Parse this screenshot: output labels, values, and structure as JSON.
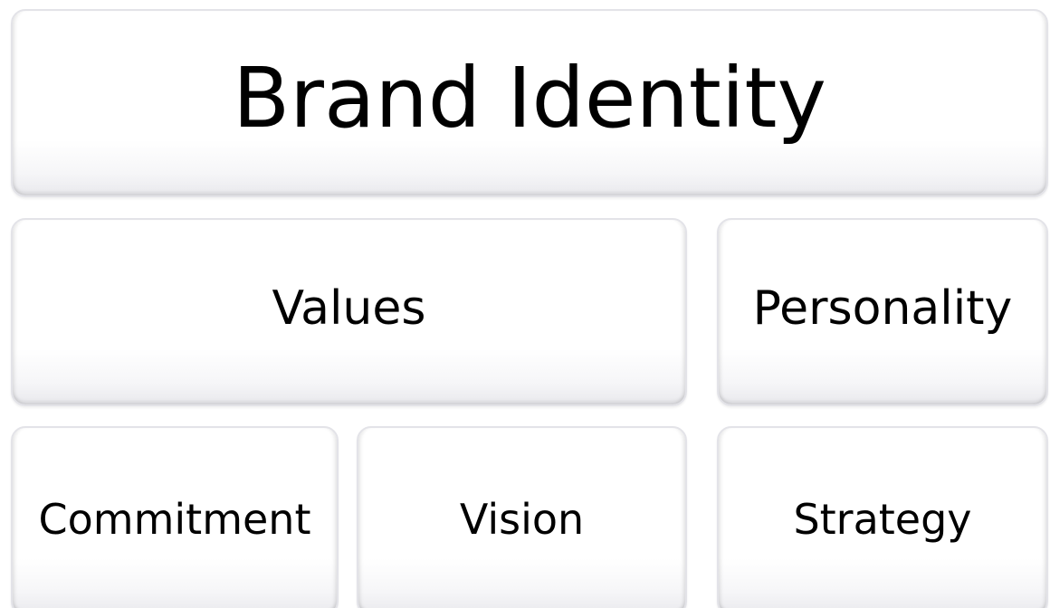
{
  "diagram": {
    "title": "Brand Identity",
    "row2": [
      {
        "label": "Values"
      },
      {
        "label": "Personality"
      }
    ],
    "row3": [
      {
        "label": "Commitment"
      },
      {
        "label": "Vision"
      },
      {
        "label": "Strategy"
      }
    ]
  }
}
